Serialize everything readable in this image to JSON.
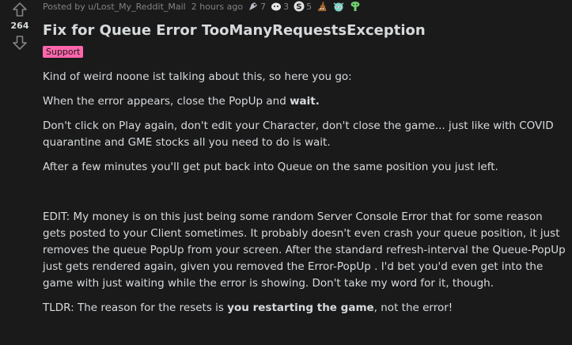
{
  "vote": {
    "score": "264"
  },
  "meta": {
    "posted_by_label": "Posted by u/Lost_My_Reddit_Mail",
    "age": "2 hours ago",
    "awards": [
      {
        "icon": "skull-award-icon",
        "count": "7",
        "color": "#b8bcc4"
      },
      {
        "icon": "face-award-icon",
        "count": "3",
        "color": "#e8e8e8"
      },
      {
        "icon": "silver-coin-award-icon",
        "count": "5",
        "color": "#e0e0e0"
      },
      {
        "icon": "poop-award-icon",
        "count": "",
        "color": "#a0642d"
      },
      {
        "icon": "creature-award-icon",
        "count": "",
        "color": "#7ed3c4"
      },
      {
        "icon": "plant-award-icon",
        "count": "",
        "color": "#6fcf6a"
      }
    ]
  },
  "post": {
    "title": "Fix for Queue Error TooManyRequestsException",
    "flair": "Support",
    "flair_color": "#ff66ac",
    "p1": "Kind of weird noone ist talking about this, so here you go:",
    "p2_prefix": "When the error appears, close the PopUp and ",
    "p2_bold": "wait.",
    "p3": "Don't click on Play again, don't edit your Character, don't close the game... just like with COVID quarantine and GME stocks all you need to do is wait.",
    "p4": "After a few minutes you'll get put back into Queue on the same position you just left.",
    "p5": "EDIT: My money is on this just being some random Server Console Error that for some reason gets posted to your Client sometimes. It probably doesn't even crash your queue position, it just removes the queue PopUp from your screen. After the standard refresh-interval the Queue-PopUp just gets rendered again, given you removed the Error-PopUp . I'd bet you'd even get into the game with just waiting while the error is showing. Don't take my word for it, though.",
    "p6_prefix": "TLDR: The reason for the resets is ",
    "p6_bold": "you restarting the game",
    "p6_suffix": ", not the error!"
  }
}
